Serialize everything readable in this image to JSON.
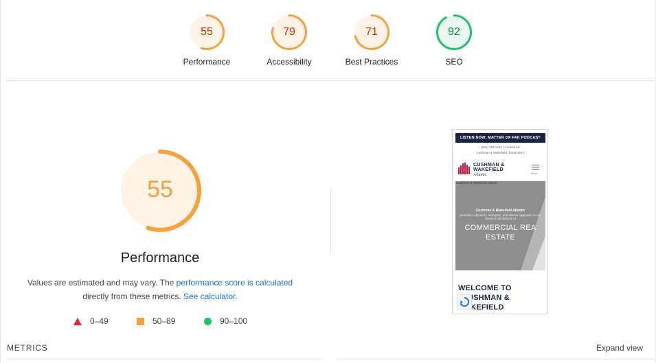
{
  "scores": [
    {
      "label": "Performance",
      "value": 55,
      "fraction": 0.55,
      "color": "#c33300",
      "stroke": "#f5a13c",
      "fill": "#fff3e6"
    },
    {
      "label": "Accessibility",
      "value": 79,
      "fraction": 0.79,
      "color": "#c33300",
      "stroke": "#f5a13c",
      "fill": "#fff3e6"
    },
    {
      "label": "Best Practices",
      "value": 71,
      "fraction": 0.71,
      "color": "#c33300",
      "stroke": "#f5a13c",
      "fill": "#fff3e6"
    },
    {
      "label": "SEO",
      "value": 92,
      "fraction": 0.92,
      "color": "#0a8741",
      "stroke": "#1ec26b",
      "fill": "#e8f8ef"
    }
  ],
  "main": {
    "score": 55,
    "fraction": 0.55,
    "title": "Performance",
    "desc_prefix": "Values are estimated and may vary. The ",
    "desc_link1": "performance score is calculated",
    "desc_middle": " directly from these metrics. ",
    "desc_link2": "See calculator.",
    "colors": {
      "stroke": "#f5a13c",
      "fill": "#fff3e6",
      "text": "#f5a13c"
    }
  },
  "legend": [
    {
      "icon": "triangle-fail-icon",
      "range": "0–49",
      "color": "#e5262a"
    },
    {
      "icon": "square-average-icon",
      "range": "50–89",
      "color": "#f5a13c"
    },
    {
      "icon": "circle-pass-icon",
      "range": "90–100",
      "color": "#1ec26b"
    }
  ],
  "thumbnail": {
    "banner": "LISTEN NOW: MATTER OF FAK PODCAST",
    "contact_line1": "(902) 425 1444  |  Contact Us",
    "contact_line2": "Cushman & Wakefield Global Site  |",
    "logo_name_1": "CUSHMAN &",
    "logo_name_2": "WAKEFIELD",
    "logo_sub": "Atlantic",
    "menu_label": "Menu",
    "hero_alt": "Cushman & Wakefield Atlantic",
    "hero_sub1": "Cushman & Wakefield Atlantic",
    "hero_sub2": "provides a dynamic, energetic, and diverse approach to our clients in all aspects of",
    "hero_big_1": "COMMERCIAL REA",
    "hero_big_2": "ESTATE",
    "welcome_1": "WELCOME TO",
    "welcome_2": "USHMAN &",
    "welcome_3": "AKEFIELD"
  },
  "footer": {
    "metrics_label": "METRICS",
    "expand_label": "Expand view"
  }
}
